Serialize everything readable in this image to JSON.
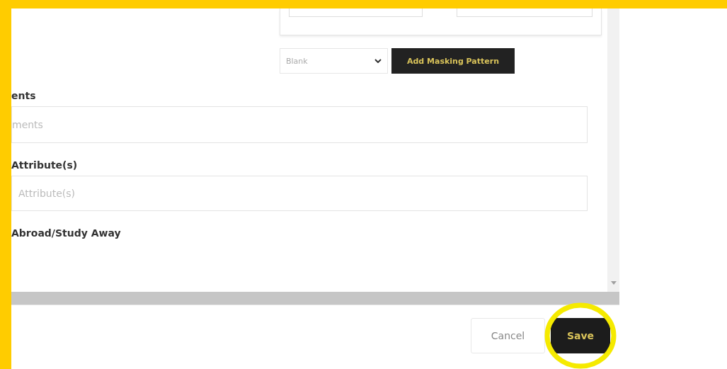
{
  "card": {
    "fields": [
      {
        "kind": "select"
      },
      {
        "kind": "text"
      }
    ]
  },
  "masking": {
    "select": {
      "placeholder": "Blank"
    },
    "button": "Add Masking Pattern"
  },
  "form": [
    {
      "label": "ents",
      "placeholder": "ments"
    },
    {
      "label": "Attribute(s)",
      "placeholder": "Attribute(s)"
    },
    {
      "label": "Abroad/Study Away"
    }
  ],
  "footer": {
    "buttons": [
      {
        "label": "Cancel",
        "kind": "secondary",
        "highlighted": false
      },
      {
        "label": "Save",
        "kind": "primary",
        "highlighted": true
      }
    ]
  }
}
